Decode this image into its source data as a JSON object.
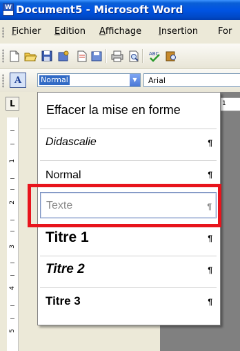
{
  "window": {
    "title": "Document5 - Microsoft Word",
    "app_icon_letter": "W"
  },
  "menubar": {
    "items": [
      {
        "label": "Fichier",
        "accel": "F",
        "rest": "ichier"
      },
      {
        "label": "Edition",
        "accel": "E",
        "rest": "dition"
      },
      {
        "label": "Affichage",
        "accel": "A",
        "rest": "ffichage"
      },
      {
        "label": "Insertion",
        "accel": "I",
        "rest": "nsertion"
      },
      {
        "label": "For",
        "accel": "",
        "rest": "For"
      }
    ]
  },
  "standard_toolbar": {
    "icons": [
      "new-icon",
      "open-icon",
      "save-icon",
      "permission-icon",
      "email-icon",
      "print-icon",
      "print-preview-icon",
      "research-icon",
      "spelling-icon",
      "research-book-icon"
    ]
  },
  "formatting_toolbar": {
    "styles_icon_text": "A",
    "style_value": "Normal",
    "font_value": "Arial"
  },
  "ruler": {
    "h_number": "1",
    "tab_glyph": "L",
    "v_numbers": [
      "1",
      "2",
      "3",
      "4",
      "5"
    ]
  },
  "style_dropdown": {
    "clear_label": "Effacer la mise en forme",
    "pilcrow": "¶",
    "items": [
      {
        "label": "Didascalie"
      },
      {
        "label": "Normal"
      },
      {
        "label": "Texte",
        "state": "hover"
      },
      {
        "label": "Titre 1"
      },
      {
        "label": "Titre 2"
      },
      {
        "label": "Titre 3"
      }
    ]
  },
  "colors": {
    "titlebar": "#0054e3",
    "highlight": "#e8141c",
    "selection": "#316ac5"
  }
}
